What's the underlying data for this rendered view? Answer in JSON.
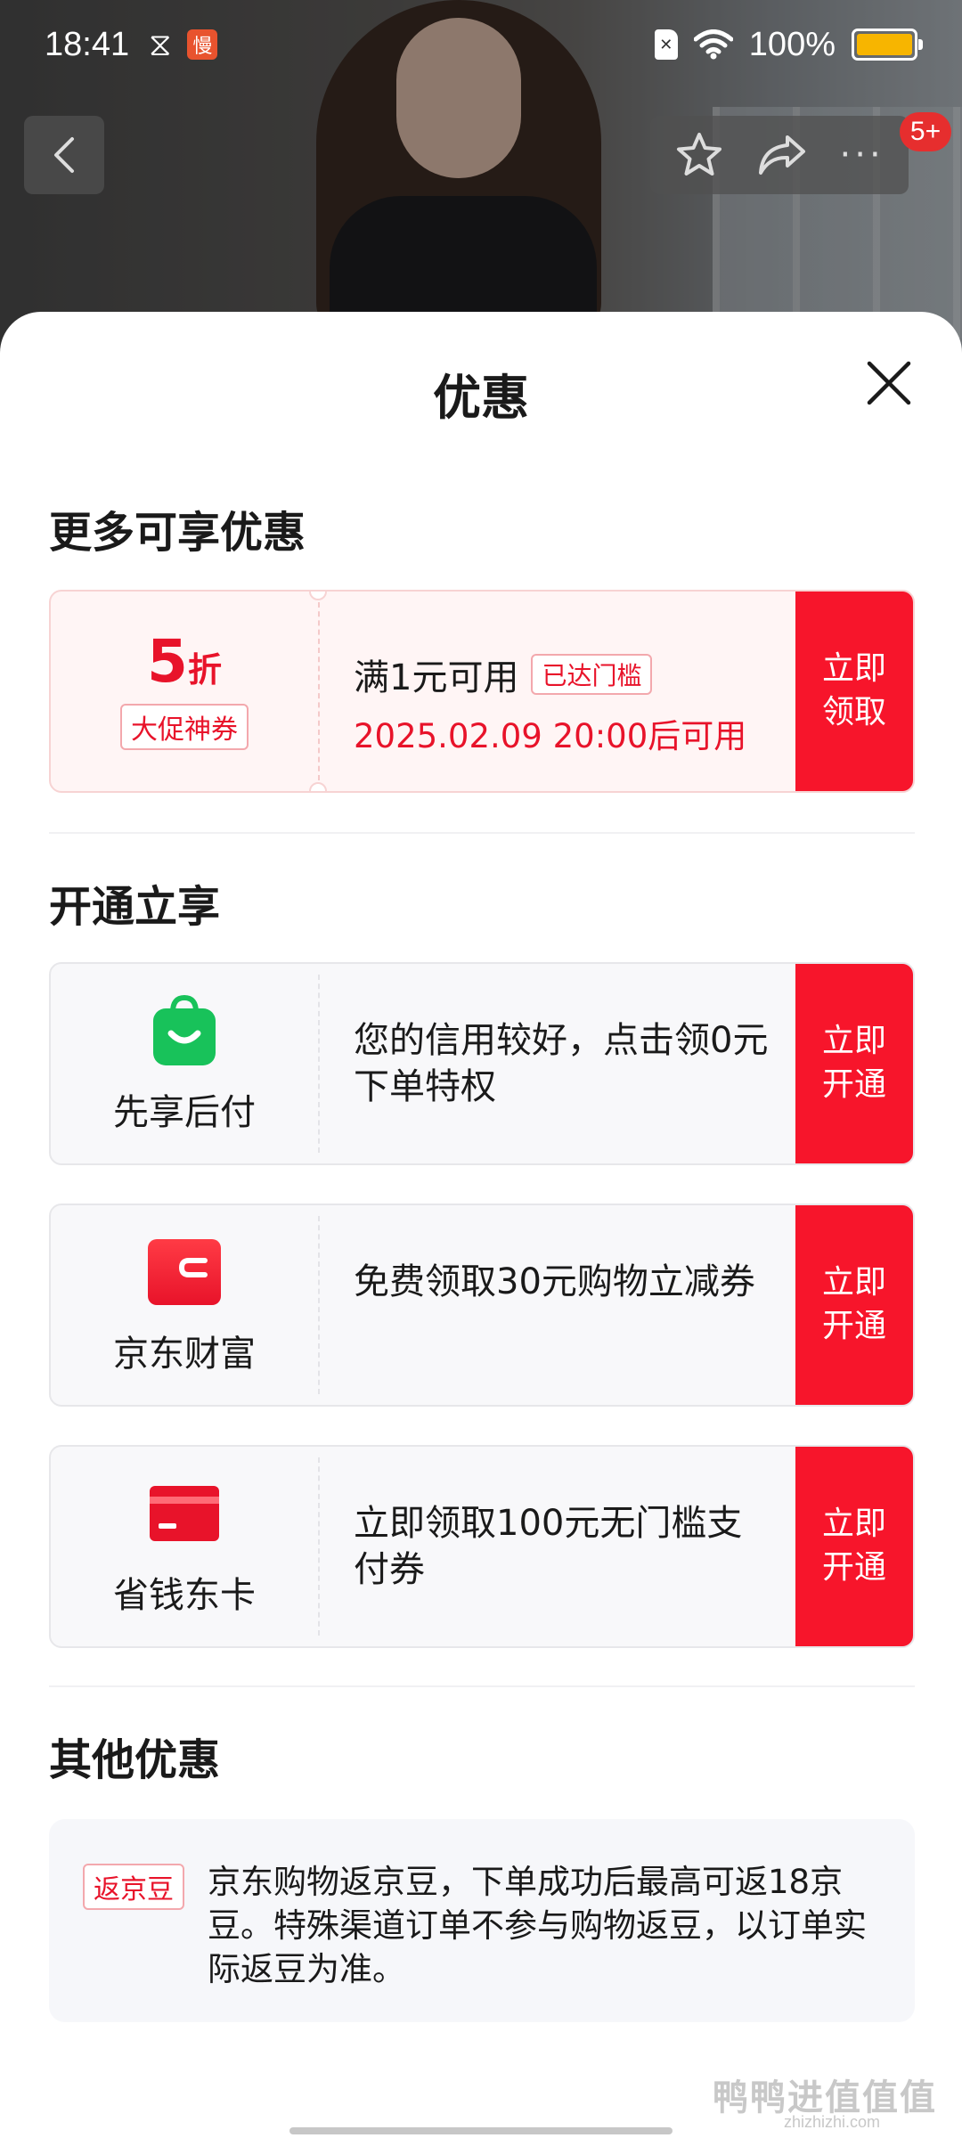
{
  "status_bar": {
    "time": "18:41",
    "app_badge": "慢",
    "battery_text": "100%",
    "battery_level": 1.0
  },
  "nav": {
    "message_count": "5+"
  },
  "sheet": {
    "title": "优惠"
  },
  "more_discounts": {
    "title": "更多可享优惠",
    "coupon": {
      "discount_value": "5",
      "discount_unit": "折",
      "tag": "大促神券",
      "condition": "满1元可用",
      "reached_badge": "已达门槛",
      "valid_from": "2025.02.09 20:00后可用",
      "action_label": "立即领取"
    }
  },
  "open_services": {
    "title": "开通立享",
    "items": [
      {
        "name": "先享后付",
        "description": "您的信用较好，点击领0元下单特权",
        "action_label": "立即开通",
        "icon": "shopping-bag-icon"
      },
      {
        "name": "京东财富",
        "description": "免费领取30元购物立减券",
        "action_label": "立即开通",
        "icon": "wallet-icon"
      },
      {
        "name": "省钱东卡",
        "description": "立即领取100元无门槛支付券",
        "action_label": "立即开通",
        "icon": "card-icon"
      }
    ]
  },
  "other_discounts": {
    "title": "其他优惠",
    "tag": "返京豆",
    "text": "京东购物返京豆，下单成功后最高可返18京豆。特殊渠道订单不参与购物返豆，以订单实际返豆为准。"
  },
  "watermark": {
    "text": "鸭鸭进值值值",
    "sub": "zhizhizhi.com"
  },
  "colors": {
    "accent_red": "#f7152b",
    "coupon_bg": "#fff5f5",
    "card_bg": "#f8f8fa",
    "green": "#18c25a"
  }
}
